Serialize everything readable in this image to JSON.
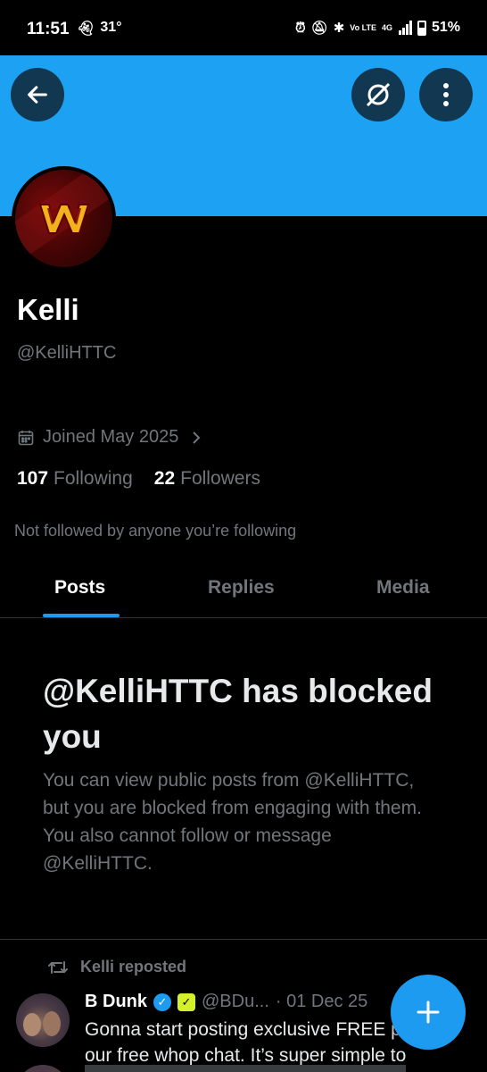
{
  "status_bar": {
    "time": "11:51",
    "temperature": "31°",
    "network": "4G",
    "volte": "Vo LTE",
    "battery": "51%"
  },
  "colors": {
    "banner": "#1da1f2",
    "accent": "#1d9bf0",
    "background": "#000000",
    "secondary_text": "#71767b"
  },
  "icons": [
    "back-arrow-icon",
    "grok-icon",
    "more-vertical-icon",
    "calendar-icon",
    "chevron-right-icon",
    "repost-icon",
    "verified-icon",
    "affiliate-icon",
    "plus-icon"
  ],
  "profile": {
    "name": "Kelli",
    "handle": "@KelliHTTC",
    "joined": "Joined May 2025",
    "following_count": "107",
    "following_label": "Following",
    "followers_count": "22",
    "followers_label": "Followers",
    "not_followed_text": "Not followed by anyone you’re following"
  },
  "tabs": [
    {
      "label": "Posts",
      "selected": true
    },
    {
      "label": "Replies",
      "selected": false
    },
    {
      "label": "Media",
      "selected": false
    }
  ],
  "blocked": {
    "title": "@KelliHTTC has blocked you",
    "description": "You can view public posts from @KelliHTTC, but you are blocked from engaging with them. You also cannot follow or message @KelliHTTC."
  },
  "post": {
    "repost_label": "Kelli reposted",
    "author": "B Dunk",
    "handle": "@BDu...",
    "date": "· 01 Dec 25",
    "text": "Gonna start posting exclusive FREE picks in our free whop chat. It’s super simple to"
  }
}
